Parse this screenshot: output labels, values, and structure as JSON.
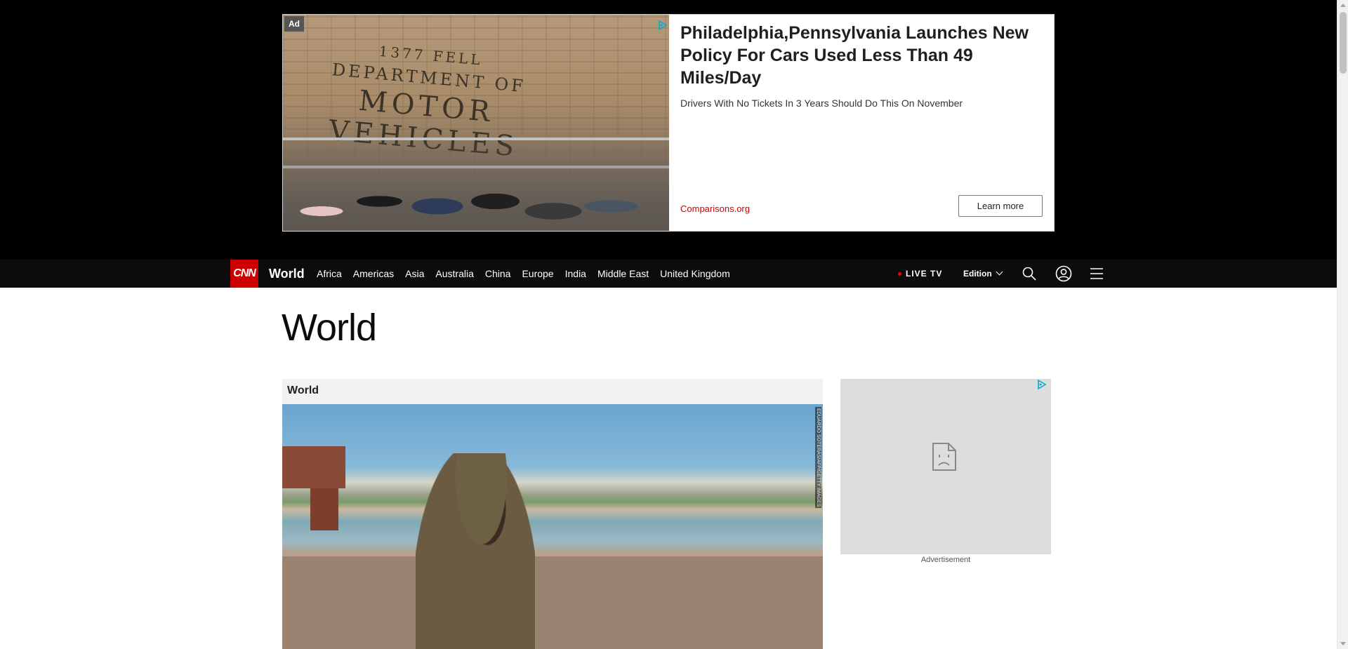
{
  "top_ad": {
    "badge": "Ad",
    "sign_line1": "1377 FELL",
    "sign_line2": "DEPARTMENT OF",
    "sign_line3": "MOTOR VEHICLES",
    "headline": "Philadelphia,Pennsylvania Launches New Policy For Cars Used Less Than 49 Miles/Day",
    "subtext": "Drivers With No Tickets In 3 Years Should Do This On November",
    "source": "Comparisons.org",
    "cta_label": "Learn more",
    "adchoices_icon": "adchoices-icon"
  },
  "nav": {
    "logo": "CNN",
    "section": "World",
    "links": [
      "Africa",
      "Americas",
      "Asia",
      "Australia",
      "China",
      "Europe",
      "India",
      "Middle East",
      "United Kingdom"
    ],
    "live_tv": "LIVE TV",
    "edition": "Edition",
    "icons": [
      "search-icon",
      "account-icon",
      "menu-icon"
    ]
  },
  "main": {
    "page_title": "World",
    "feature_label": "World",
    "photo_credit": "EDUARDO SOTERAS/AFP/GETTY IMAGES"
  },
  "side_ad": {
    "label": "Advertisement",
    "icon": "broken-page-icon"
  },
  "colors": {
    "brand_red": "#cc0000",
    "nav_bg": "#0c0c0c",
    "ad_source": "#cc0000"
  }
}
